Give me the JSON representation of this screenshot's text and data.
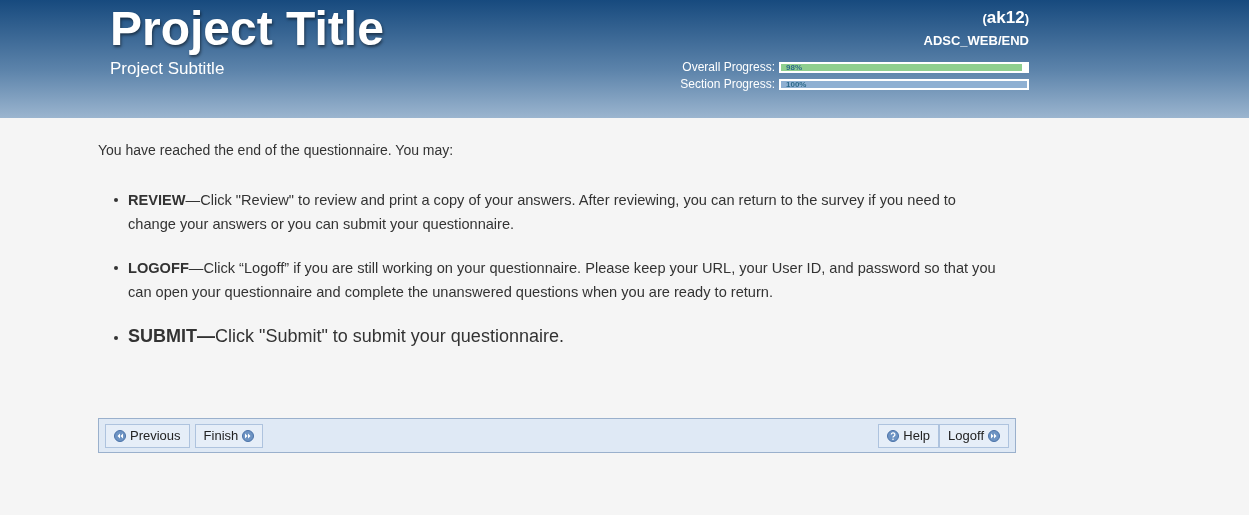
{
  "header": {
    "title": "Project Title",
    "subtitle": "Project Subtitle",
    "user_open": "(",
    "user": "ak12",
    "user_close": ")",
    "page_id": "ADSC_WEB/END",
    "progress": [
      {
        "label": "Overall Progress:",
        "reading": "98%",
        "level": 0.98,
        "color": "#8fcf8f"
      },
      {
        "label": "Section Progress:",
        "reading": "100%",
        "level": 1.0,
        "color": "#8fb0d2"
      }
    ]
  },
  "intro": "You have reached the end of the questionnaire. You may:",
  "items": [
    {
      "kind": "normal",
      "text": "**REVIEW**—Click \"Review\" to review and print a copy of your answers. After reviewing, you can return to the survey if you need to change your answers or you can submit your questionnaire."
    },
    {
      "kind": "normal",
      "text": "**LOGOFF**—Click “Logoff” if you are still working on your questionnaire. Please keep your URL, your User ID, and password so that you can open your questionnaire and complete the unanswered questions when you are ready to return."
    },
    {
      "kind": "large",
      "text": "**SUBMIT—**Click \"Submit\" to submit your questionnaire."
    }
  ],
  "nav_left": [
    {
      "label": "Previous",
      "kind": "back"
    },
    {
      "label": "Finish",
      "kind": "forward"
    }
  ],
  "nav_right": [
    {
      "label": "Help",
      "kind": "help"
    },
    {
      "label": "Logoff",
      "kind": "forward"
    }
  ]
}
